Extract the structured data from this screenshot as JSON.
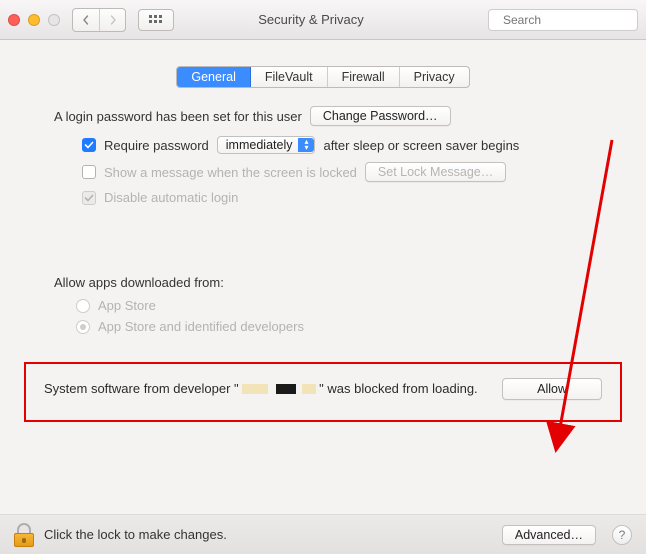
{
  "window": {
    "title": "Security & Privacy",
    "search_placeholder": "Search"
  },
  "tabs": [
    "General",
    "FileVault",
    "Firewall",
    "Privacy"
  ],
  "active_tab": "General",
  "general": {
    "login_pw_set_text": "A login password has been set for this user",
    "change_password_btn": "Change Password…",
    "require_pw_label": "Require password",
    "require_pw_delay": "immediately",
    "require_pw_suffix": "after sleep or screen saver begins",
    "show_message_label": "Show a message when the screen is locked",
    "set_lock_message_btn": "Set Lock Message…",
    "disable_auto_login_label": "Disable automatic login",
    "allow_apps_heading": "Allow apps downloaded from:",
    "allow_apps_options": [
      "App Store",
      "App Store and identified developers"
    ],
    "allow_apps_selected_index": 1,
    "blocked_msg_prefix": "System software from developer \"",
    "blocked_msg_suffix": "\" was blocked from loading.",
    "allow_btn": "Allow"
  },
  "footer": {
    "lock_text": "Click the lock to make changes.",
    "advanced_btn": "Advanced…",
    "help": "?"
  }
}
